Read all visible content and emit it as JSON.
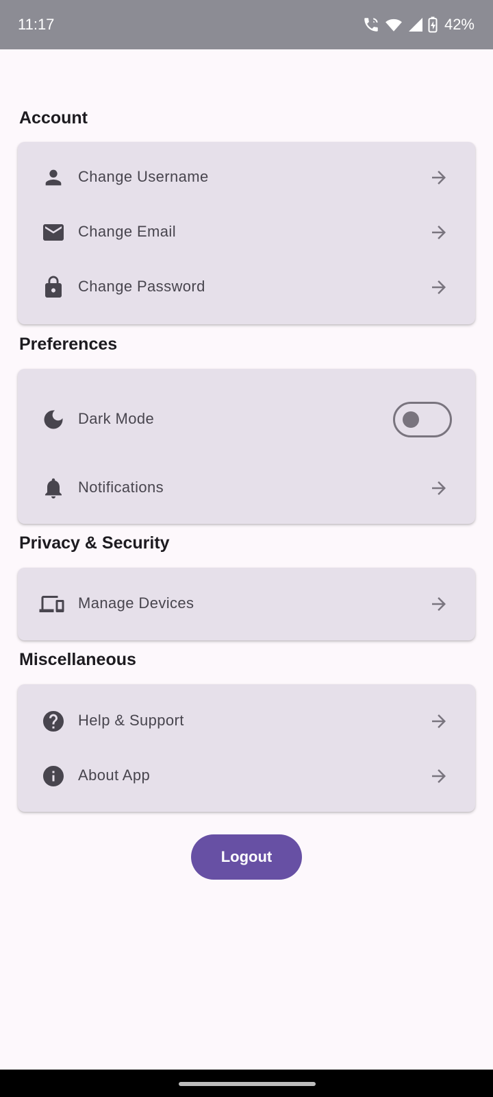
{
  "status_bar": {
    "time": "11:17",
    "battery": "42%"
  },
  "sections": {
    "account": {
      "title": "Account",
      "items": [
        {
          "label": "Change Username",
          "icon": "person-icon"
        },
        {
          "label": "Change Email",
          "icon": "mail-icon"
        },
        {
          "label": "Change Password",
          "icon": "lock-icon"
        }
      ]
    },
    "preferences": {
      "title": "Preferences",
      "items": [
        {
          "label": "Dark Mode",
          "icon": "moon-icon",
          "toggle": false
        },
        {
          "label": "Notifications",
          "icon": "bell-icon"
        }
      ]
    },
    "privacy": {
      "title": "Privacy & Security",
      "items": [
        {
          "label": "Manage Devices",
          "icon": "devices-icon"
        }
      ]
    },
    "misc": {
      "title": "Miscellaneous",
      "items": [
        {
          "label": "Help & Support",
          "icon": "help-icon"
        },
        {
          "label": "About App",
          "icon": "info-icon"
        }
      ]
    }
  },
  "logout_label": "Logout",
  "colors": {
    "accent": "#6750a4",
    "card": "#e6e0ea",
    "background": "#fdf8fc",
    "status_bar": "#8c8c94"
  }
}
